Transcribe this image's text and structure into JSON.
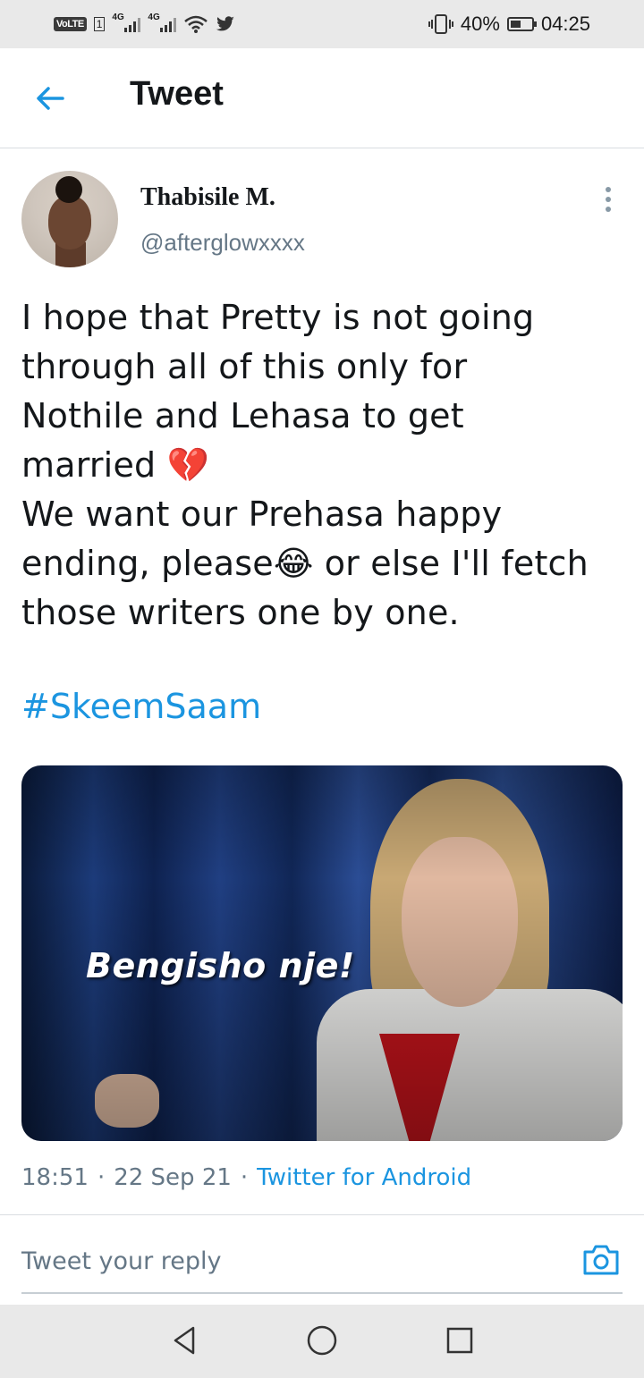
{
  "status_bar": {
    "volte": "VoLTE",
    "sim": "1",
    "network1": "4G",
    "network2": "4G",
    "battery": "40%",
    "time": "04:25"
  },
  "header": {
    "title": "Tweet"
  },
  "tweet": {
    "author_name": "Thabisile M.",
    "author_handle": "@afterglowxxxx",
    "text_lines": [
      "I hope that Pretty is not going",
      "through all of this only for",
      "Nothile and Lehasa to get",
      "married 💔",
      "We want our Prehasa happy",
      "ending, please😂 or else I'll fetch",
      "those writers one by one."
    ],
    "hashtag": "#SkeemSaam",
    "media_caption": "Bengisho nje!",
    "time": "18:51",
    "separator": "·",
    "date": "22 Sep 21",
    "source": "Twitter for Android"
  },
  "reply": {
    "placeholder": "Tweet your reply"
  },
  "colors": {
    "accent": "#1b95e0",
    "muted_text": "#657786",
    "divider": "#d9dde1"
  },
  "icons": [
    "back-arrow-icon",
    "more-vertical-icon",
    "camera-icon",
    "nav-back-icon",
    "nav-home-icon",
    "nav-recent-icon",
    "twitter-bird-icon",
    "wifi-icon",
    "vibrate-icon",
    "battery-icon"
  ]
}
